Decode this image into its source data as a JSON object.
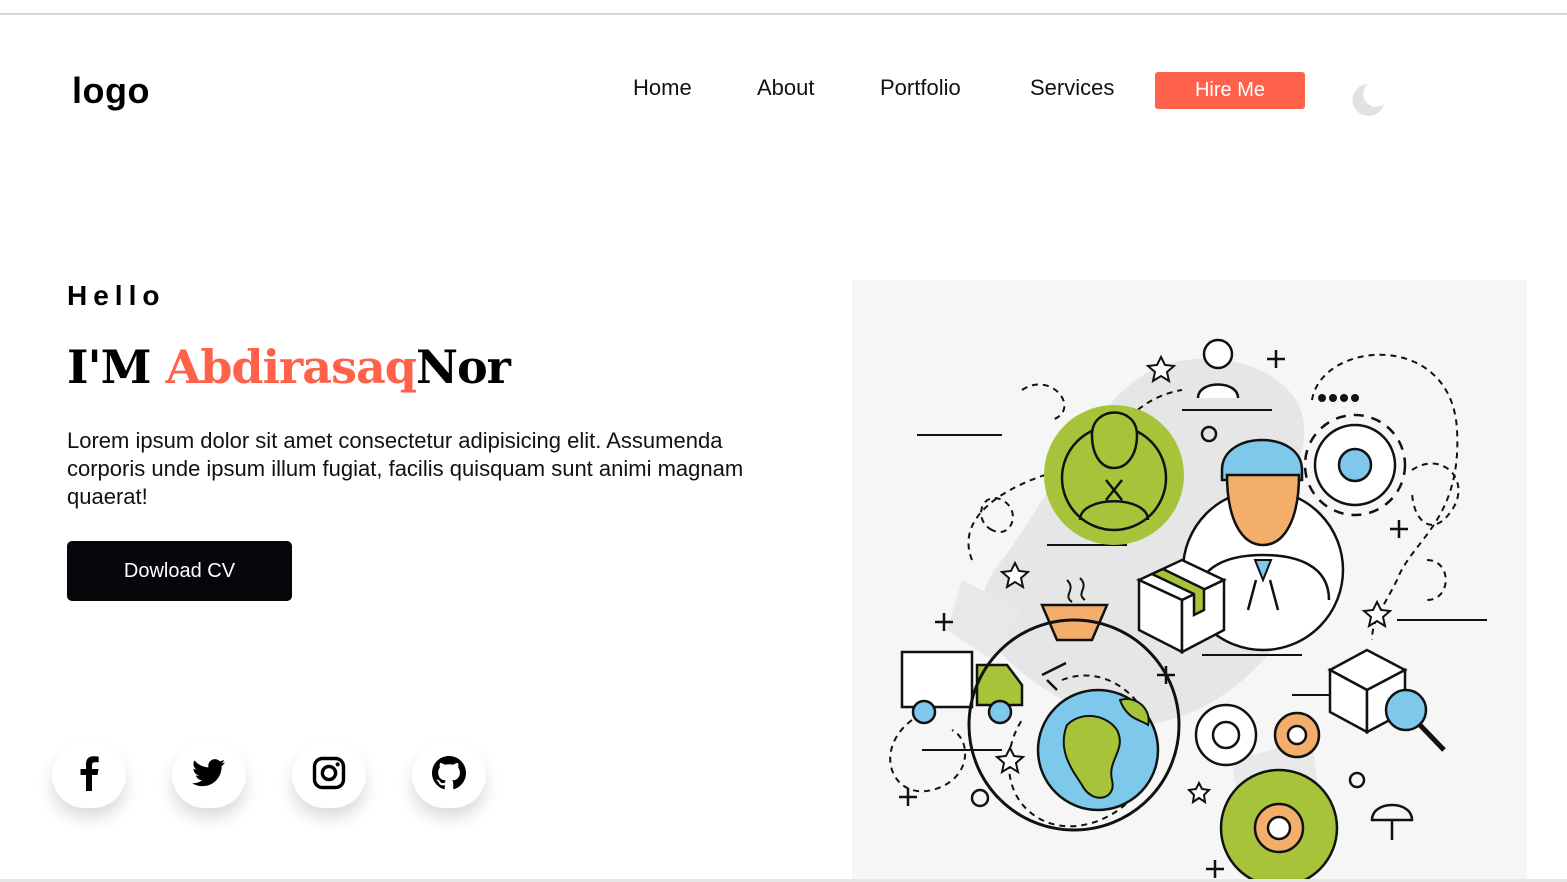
{
  "header": {
    "logo": "logo",
    "nav": [
      "Home",
      "About",
      "Portfolio",
      "Services"
    ],
    "hire_label": "Hire Me",
    "theme_icon": "moon-icon"
  },
  "hero": {
    "greeting": "Hello",
    "headline_prefix": "I'M ",
    "name_first": "Abdirasaq",
    "name_last": "Nor",
    "lead": "Lorem ipsum dolor sit amet consectetur adipisicing elit. Assumenda corporis unde ipsum illum fugiat, facilis quisquam sunt animi magnam quaerat!",
    "cv_label": "Dowload CV",
    "illustration": "business-logistics-illustration"
  },
  "social": [
    "facebook-icon",
    "twitter-icon",
    "instagram-icon",
    "github-icon"
  ],
  "colors": {
    "accent": "#ff614a",
    "button_dark": "#05060a",
    "green": "#a6c33a",
    "blue": "#7ec8ec",
    "orange": "#f3ae6c"
  }
}
